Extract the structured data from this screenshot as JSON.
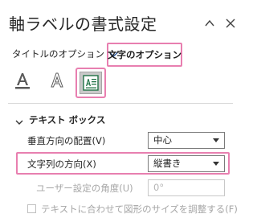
{
  "pane": {
    "title": "軸ラベルの書式設定",
    "icons": {
      "collapse": "chevron-up-icon",
      "close": "close-icon"
    }
  },
  "tabs": {
    "title_options": "タイトルのオプション",
    "text_options": "文字のオプション"
  },
  "icon_tabs": [
    {
      "name": "text-fill-outline-icon"
    },
    {
      "name": "text-effects-icon"
    },
    {
      "name": "textbox-icon",
      "selected": true
    }
  ],
  "section": {
    "title": "テキスト ボックス",
    "vertical_alignment": {
      "label": "垂直方向の配置(V)",
      "value": "中心"
    },
    "text_direction": {
      "label": "文字列の方向(X)",
      "value": "縦書き"
    },
    "custom_angle": {
      "label": "ユーザー設定の角度(U)",
      "value": "0°"
    },
    "autofit_checkbox": {
      "label": "テキストに合わせて図形のサイズを調整する(F)",
      "checked": false
    }
  },
  "colors": {
    "highlight": "#e87fb0",
    "accent_blue": "#2b579a"
  }
}
